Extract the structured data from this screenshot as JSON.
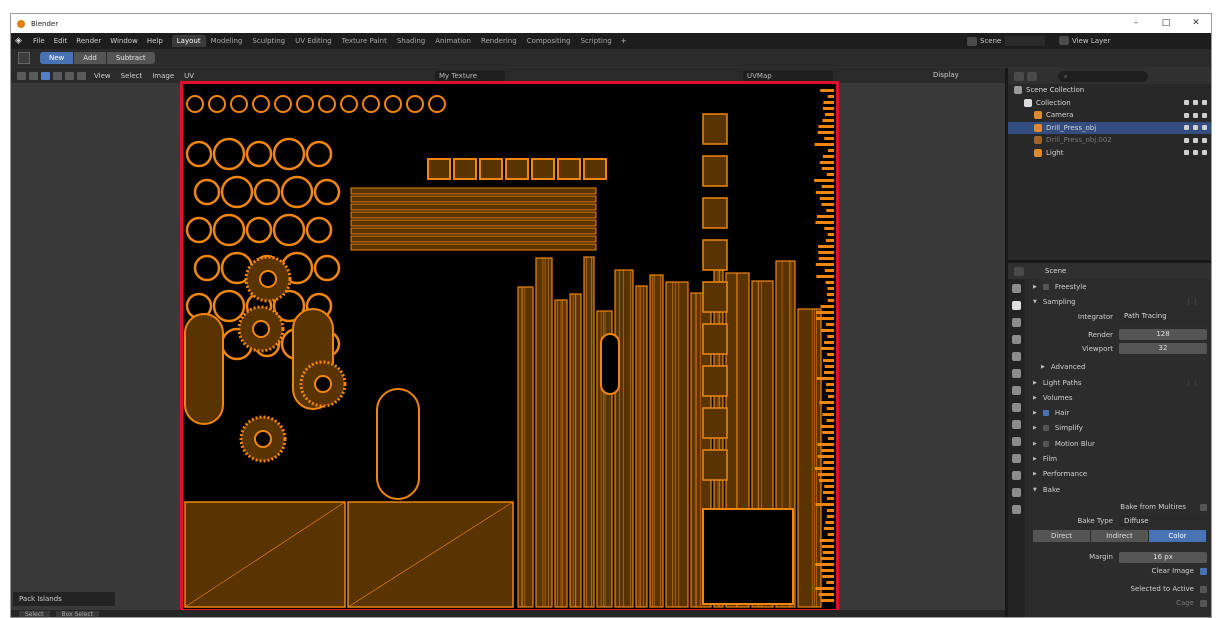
{
  "window": {
    "title": "Blender",
    "controls": [
      "–",
      "□",
      "✕"
    ]
  },
  "menubar": {
    "items": [
      "File",
      "Edit",
      "Render",
      "Window",
      "Help"
    ],
    "workspaces": [
      "Layout",
      "Modeling",
      "Sculpting",
      "UV Editing",
      "Texture Paint",
      "Shading",
      "Animation",
      "Rendering",
      "Compositing",
      "Scripting"
    ],
    "active_workspace": "Layout",
    "add_tab": "+",
    "scene_label": "Scene",
    "view_layer_label": "View Layer"
  },
  "tool_header": {
    "new": "New",
    "add": "Add",
    "subtract": "Subtract"
  },
  "editor_header": {
    "view": "View",
    "select": "Select",
    "image": "Image",
    "uv": "UV",
    "image_name": "My Texture",
    "uv_map": "UVMap",
    "display": "Display"
  },
  "uv_canvas": {
    "background": "#000000",
    "island_fill": "#5a3400",
    "edge_color": "#f0860f",
    "frame_color": "#e0102a"
  },
  "last_operator": "Pack Islands",
  "statusbar": {
    "chips": [
      "Select",
      "Box Select"
    ]
  },
  "outliner": {
    "search_placeholder": "",
    "rows": [
      {
        "label": "Scene Collection",
        "indent": 0,
        "selected": false,
        "dim": false,
        "icon_color": "#9a9a9a"
      },
      {
        "label": "Collection",
        "indent": 1,
        "selected": false,
        "dim": false,
        "icon_color": "#dcdcdc"
      },
      {
        "label": "Camera",
        "indent": 2,
        "selected": false,
        "dim": false,
        "icon_color": "#e08a2e"
      },
      {
        "label": "Drill_Press_obj",
        "indent": 2,
        "selected": true,
        "dim": false,
        "icon_color": "#e08a2e"
      },
      {
        "label": "Drill_Press_obj.002",
        "indent": 2,
        "selected": false,
        "dim": true,
        "icon_color": "#a0642a"
      },
      {
        "label": "Light",
        "indent": 2,
        "selected": false,
        "dim": false,
        "icon_color": "#e08a2e"
      }
    ]
  },
  "properties": {
    "scene_label": "Scene",
    "panels_top": [
      {
        "label": "Freestyle",
        "checkbox": true,
        "checked": false
      },
      {
        "label": "Sampling",
        "checkbox": false,
        "checked": false
      }
    ],
    "integrator_label": "Integrator",
    "integrator_value": "Path Tracing",
    "render_label": "Render",
    "render_value": "128",
    "viewport_label": "Viewport",
    "viewport_value": "32",
    "advanced_label": "Advanced",
    "panels_mid": [
      {
        "label": "Light Paths",
        "checkbox": false,
        "checked": false
      },
      {
        "label": "Volumes",
        "checkbox": false,
        "checked": false
      },
      {
        "label": "Hair",
        "checkbox": true,
        "checked": true
      },
      {
        "label": "Simplify",
        "checkbox": true,
        "checked": false
      },
      {
        "label": "Motion Blur",
        "checkbox": true,
        "checked": false
      },
      {
        "label": "Film",
        "checkbox": false,
        "checked": false
      },
      {
        "label": "Performance",
        "checkbox": false,
        "checked": false
      },
      {
        "label": "Bake",
        "checkbox": false,
        "checked": false
      }
    ],
    "bake_from_multires": "Bake from Multires",
    "bake_type_label": "Bake Type",
    "bake_type_value": "Diffuse",
    "contrib": [
      "Direct",
      "Indirect",
      "Color"
    ],
    "margin_label": "Margin",
    "margin_value": "16 px",
    "clear_image": "Clear Image",
    "selected_to_active": "Selected to Active",
    "cage": "Cage"
  }
}
